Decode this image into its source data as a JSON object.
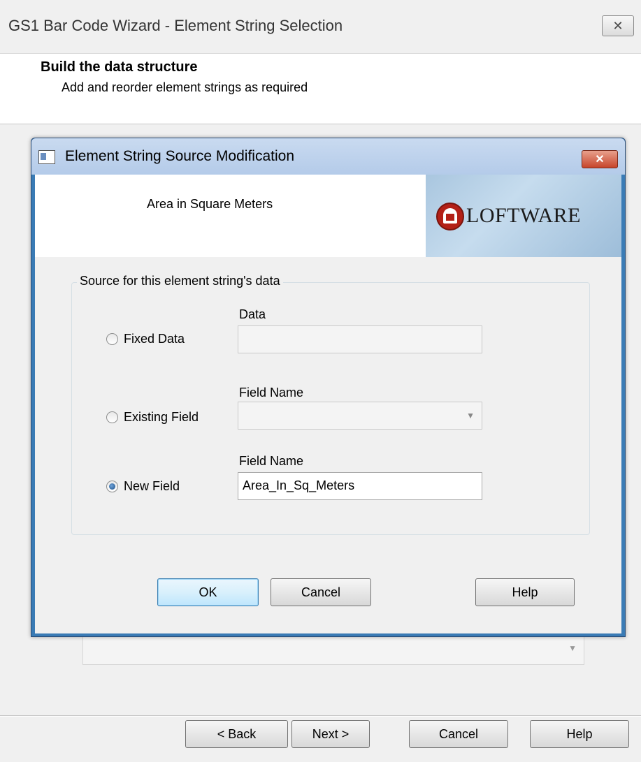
{
  "wizard": {
    "title": "GS1 Bar Code Wizard - Element String Selection",
    "close_glyph": "✕",
    "header_title": "Build the data structure",
    "header_subtitle": "Add and reorder element strings as required",
    "buttons": {
      "back": "< Back",
      "next": "Next >",
      "cancel": "Cancel",
      "help": "Help"
    }
  },
  "dialog": {
    "title": "Element String Source Modification",
    "close_glyph": "✕",
    "subject": "Area in Square Meters",
    "logo_text": "LOFTWARE",
    "group_label": "Source for this element string's data",
    "options": {
      "fixed": {
        "label": "Fixed Data",
        "field_label": "Data",
        "value": "",
        "checked": false
      },
      "existing": {
        "label": "Existing Field",
        "field_label": "Field Name",
        "value": "",
        "checked": false
      },
      "new": {
        "label": "New Field",
        "field_label": "Field Name",
        "value": "Area_In_Sq_Meters",
        "checked": true
      }
    },
    "buttons": {
      "ok": "OK",
      "cancel": "Cancel",
      "help": "Help"
    }
  },
  "colors": {
    "dialog_frame": "#3a7bb5",
    "close_button": "#c7452b",
    "logo_red": "#b32017"
  }
}
